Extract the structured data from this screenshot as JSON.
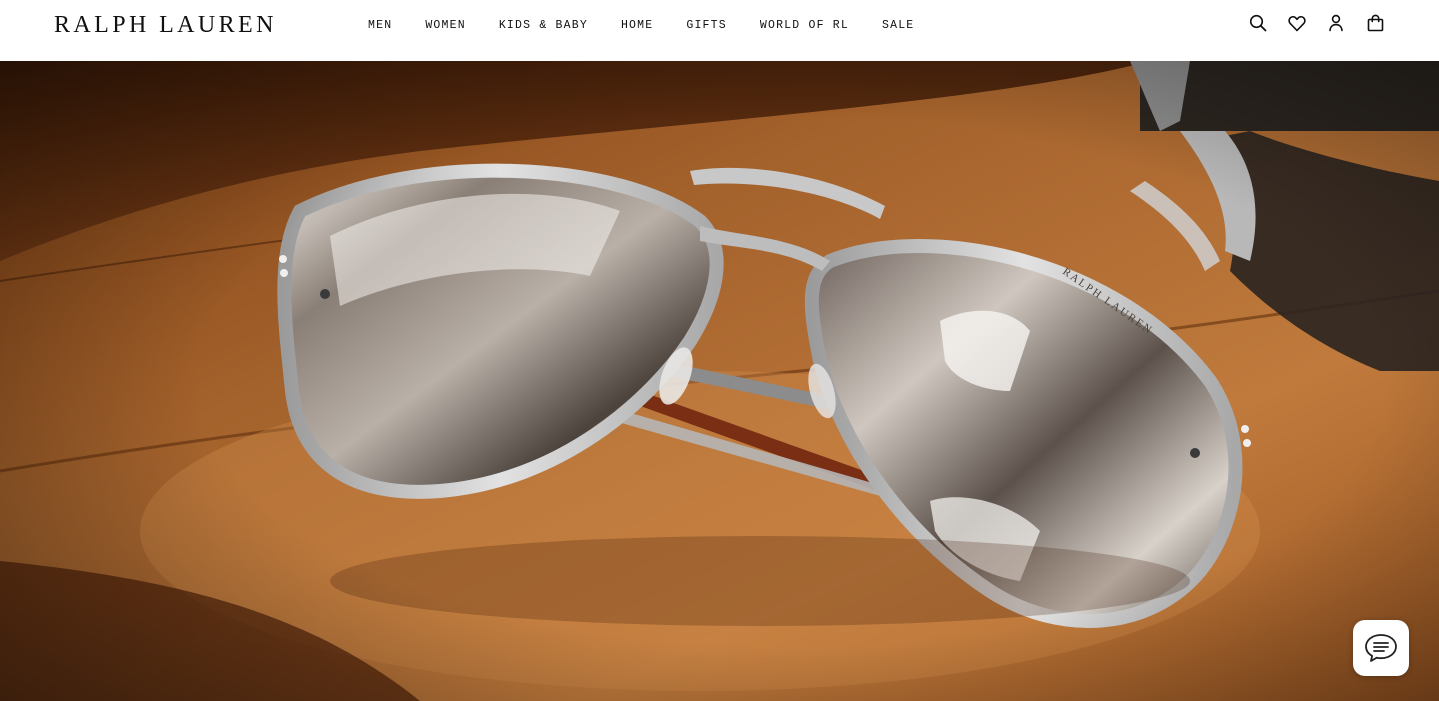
{
  "brand": {
    "logo_text": "RALPH LAUREN"
  },
  "nav": {
    "items": [
      {
        "label": "MEN"
      },
      {
        "label": "WOMEN"
      },
      {
        "label": "KIDS & BABY"
      },
      {
        "label": "HOME"
      },
      {
        "label": "GIFTS"
      },
      {
        "label": "WORLD OF RL"
      },
      {
        "label": "SALE"
      }
    ]
  },
  "utility": {
    "icons": [
      "search-icon",
      "heart-icon",
      "account-icon",
      "shopping-bag-icon"
    ]
  },
  "hero": {
    "image_subject": "aviator-sunglasses-on-leather",
    "lens_engraving": "RALPH LAUREN"
  },
  "chat": {
    "icon": "chat-bubble-icon"
  },
  "colors": {
    "header_bg": "#ffffff",
    "text": "#111111",
    "leather": "#a4622c",
    "frame": "#c9c9c9"
  }
}
